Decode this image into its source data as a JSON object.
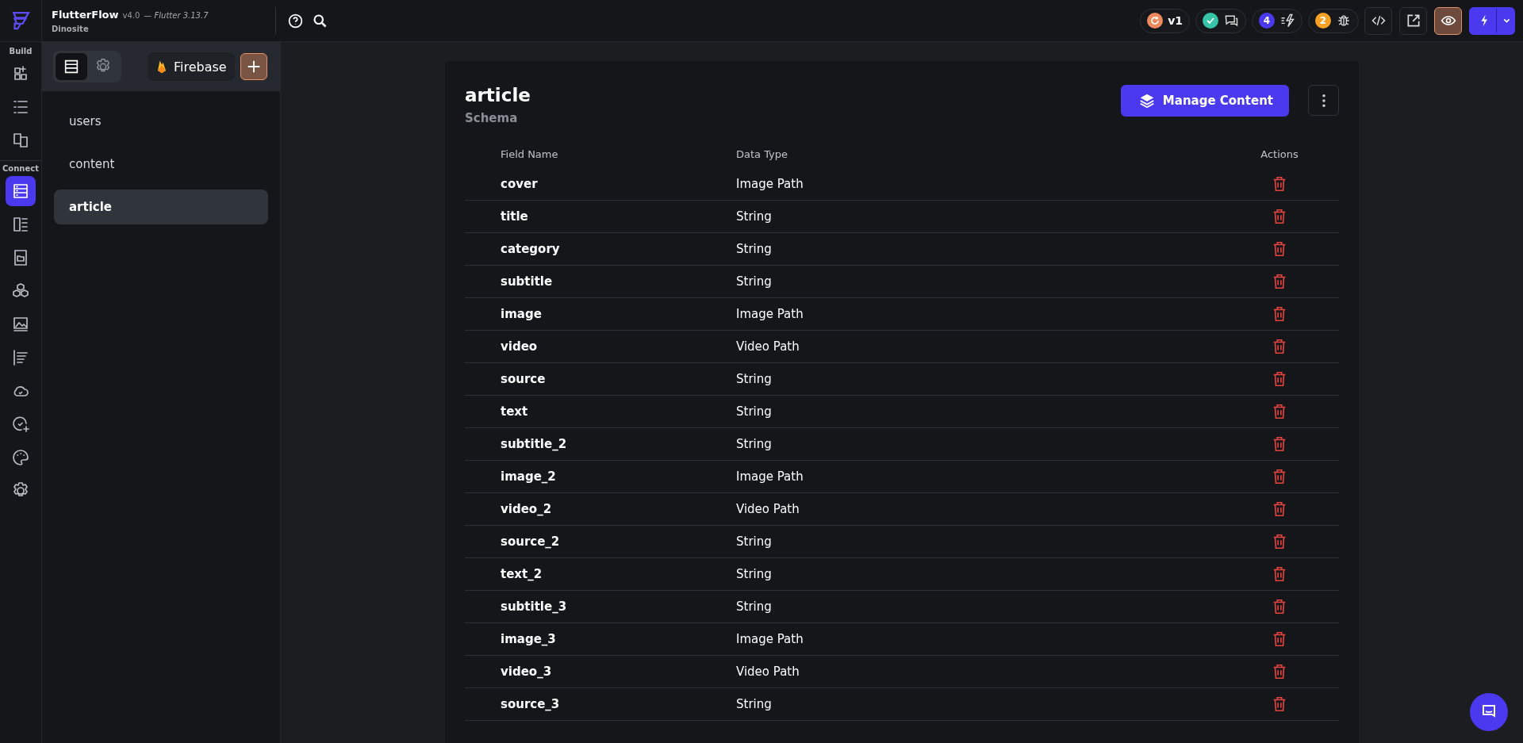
{
  "app": {
    "name": "FlutterFlow",
    "version": "v4.0",
    "flutter": "— Flutter 3.13.7",
    "project": "Dinosite"
  },
  "toolbar": {
    "version_badge": "v1",
    "build_count": "4",
    "bug_count": "2",
    "preview_active": true
  },
  "rail": [
    {
      "label": "Build",
      "items": [
        {
          "selected": false
        },
        {
          "selected": false
        },
        {
          "selected": false
        }
      ]
    },
    {
      "label": "Connect",
      "items": [
        {
          "selected": true
        },
        {
          "selected": false
        },
        {
          "selected": false
        },
        {
          "selected": false
        },
        {
          "selected": false
        },
        {
          "selected": false
        },
        {
          "selected": false
        },
        {
          "selected": false
        },
        {
          "selected": false
        },
        {
          "selected": false
        }
      ]
    }
  ],
  "panel": {
    "tabs": [
      {
        "kind": "data",
        "selected": true
      },
      {
        "kind": "settings",
        "selected": false
      }
    ],
    "source_button": "Firebase",
    "collections": [
      {
        "name": "users",
        "selected": false
      },
      {
        "name": "content",
        "selected": false
      },
      {
        "name": "article",
        "selected": true
      }
    ]
  },
  "schema": {
    "title": "article",
    "subtitle": "Schema",
    "manage_button": "Manage Content",
    "columns": [
      "Field Name",
      "Data Type",
      "Actions"
    ],
    "rows": [
      {
        "field": "cover",
        "type": "Image Path"
      },
      {
        "field": "title",
        "type": "String"
      },
      {
        "field": "category",
        "type": "String"
      },
      {
        "field": "subtitle",
        "type": "String"
      },
      {
        "field": "image",
        "type": "Image Path"
      },
      {
        "field": "video",
        "type": "Video Path"
      },
      {
        "field": "source",
        "type": "String"
      },
      {
        "field": "text",
        "type": "String"
      },
      {
        "field": "subtitle_2",
        "type": "String"
      },
      {
        "field": "image_2",
        "type": "Image Path"
      },
      {
        "field": "video_2",
        "type": "Video Path"
      },
      {
        "field": "source_2",
        "type": "String"
      },
      {
        "field": "text_2",
        "type": "String"
      },
      {
        "field": "subtitle_3",
        "type": "String"
      },
      {
        "field": "image_3",
        "type": "Image Path"
      },
      {
        "field": "video_3",
        "type": "Video Path"
      },
      {
        "field": "source_3",
        "type": "String"
      }
    ]
  }
}
